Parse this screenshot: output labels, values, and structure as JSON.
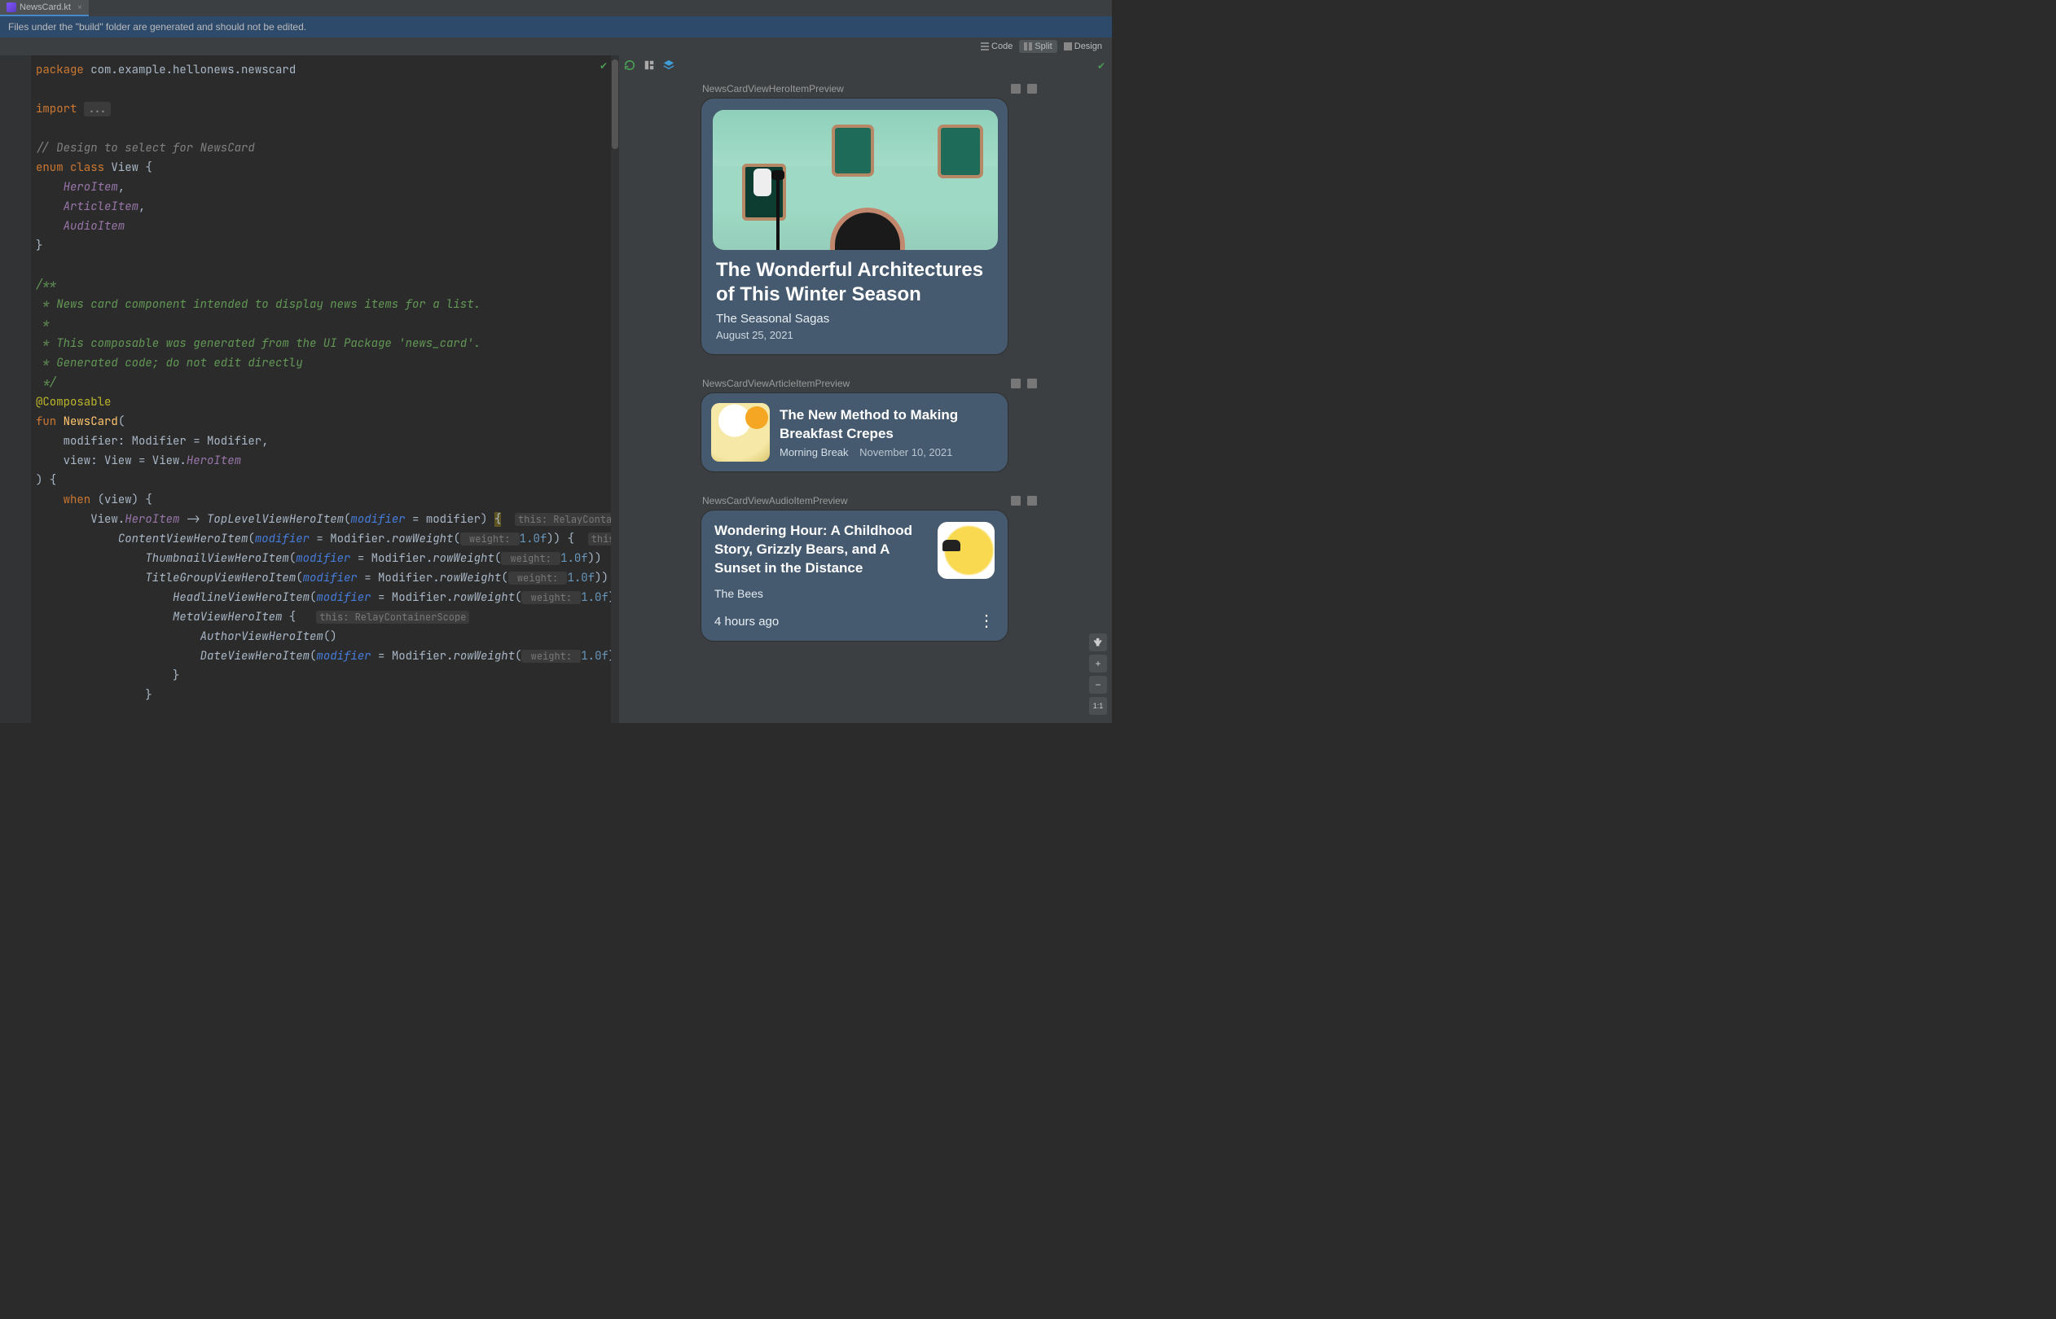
{
  "tab": {
    "filename": "NewsCard.kt"
  },
  "notice": "Files under the \"build\" folder are generated and should not be edited.",
  "viewModes": {
    "code": "Code",
    "split": "Split",
    "design": "Design",
    "selected": "Split"
  },
  "code": {
    "lines": [
      {
        "t": "pkg",
        "tokens": [
          [
            "kw",
            "package"
          ],
          [
            "sp",
            " "
          ],
          [
            "pkg",
            "com.example.hellonews.newscard"
          ]
        ]
      },
      {
        "t": "blank"
      },
      {
        "t": "imp",
        "tokens": [
          [
            "kw",
            "import"
          ],
          [
            "sp",
            " "
          ],
          [
            "fold",
            "..."
          ]
        ]
      },
      {
        "t": "blank"
      },
      {
        "t": "c",
        "text": "// Design to select for NewsCard"
      },
      {
        "tokens": [
          [
            "kw",
            "enum class"
          ],
          [
            "sp",
            " "
          ],
          [
            "type",
            "View"
          ],
          [
            "sp",
            " "
          ],
          [
            "brace",
            "{"
          ]
        ]
      },
      {
        "indent": 1,
        "tokens": [
          [
            "enum",
            "HeroItem"
          ],
          [
            "plain",
            ","
          ]
        ]
      },
      {
        "indent": 1,
        "tokens": [
          [
            "enum",
            "ArticleItem"
          ],
          [
            "plain",
            ","
          ]
        ]
      },
      {
        "indent": 1,
        "tokens": [
          [
            "enum",
            "AudioItem"
          ]
        ]
      },
      {
        "tokens": [
          [
            "brace",
            "}"
          ]
        ]
      },
      {
        "t": "blank"
      },
      {
        "t": "doc",
        "text": "/**"
      },
      {
        "t": "doc",
        "text": " * News card component intended to display news items for a list."
      },
      {
        "t": "doc",
        "text": " *"
      },
      {
        "t": "doc",
        "text": " * This composable was generated from the UI Package 'news_card'."
      },
      {
        "t": "doc",
        "text": " * Generated code; do not edit directly"
      },
      {
        "t": "doc",
        "text": " */"
      },
      {
        "tokens": [
          [
            "ann",
            "@Composable"
          ]
        ]
      },
      {
        "tokens": [
          [
            "kw",
            "fun"
          ],
          [
            "sp",
            " "
          ],
          [
            "fn",
            "NewsCard"
          ],
          [
            "plain",
            "("
          ]
        ]
      },
      {
        "indent": 1,
        "tokens": [
          [
            "param",
            "modifier: Modifier = Modifier"
          ],
          [
            "plain",
            ","
          ]
        ]
      },
      {
        "indent": 1,
        "tokens": [
          [
            "param",
            "view: View = View."
          ],
          [
            "enum",
            "HeroItem"
          ]
        ]
      },
      {
        "tokens": [
          [
            "plain",
            ") {"
          ]
        ]
      },
      {
        "indent": 1,
        "tokens": [
          [
            "kw",
            "when"
          ],
          [
            "sp",
            " "
          ],
          [
            "plain",
            "(view) {"
          ]
        ]
      },
      {
        "indent": 2,
        "tokens": [
          [
            "plain",
            "View."
          ],
          [
            "enum",
            "HeroItem"
          ],
          [
            "plain",
            " -> "
          ],
          [
            "call",
            "TopLevelViewHeroItem"
          ],
          [
            "plain",
            "("
          ],
          [
            "named",
            "modifier"
          ],
          [
            "plain",
            " = modifier) "
          ],
          [
            "hlbrace",
            "{"
          ],
          [
            "sp",
            "  "
          ],
          [
            "hint",
            "this: RelayContain"
          ]
        ]
      },
      {
        "indent": 3,
        "tokens": [
          [
            "call",
            "ContentViewHeroItem"
          ],
          [
            "plain",
            "("
          ],
          [
            "named",
            "modifier"
          ],
          [
            "plain",
            " = Modifier."
          ],
          [
            "call",
            "rowWeight"
          ],
          [
            "plain",
            "("
          ],
          [
            "hint",
            " weight: "
          ],
          [
            "num",
            "1.0f"
          ],
          [
            "plain",
            ")) {  "
          ],
          [
            "hint",
            "this: R"
          ]
        ]
      },
      {
        "indent": 4,
        "tokens": [
          [
            "call",
            "ThumbnailViewHeroItem"
          ],
          [
            "plain",
            "("
          ],
          [
            "named",
            "modifier"
          ],
          [
            "plain",
            " = Modifier."
          ],
          [
            "call",
            "rowWeight"
          ],
          [
            "plain",
            "("
          ],
          [
            "hint",
            " weight: "
          ],
          [
            "num",
            "1.0f"
          ],
          [
            "plain",
            "))"
          ]
        ]
      },
      {
        "indent": 4,
        "tokens": [
          [
            "call",
            "TitleGroupViewHeroItem"
          ],
          [
            "plain",
            "("
          ],
          [
            "named",
            "modifier"
          ],
          [
            "plain",
            " = Modifier."
          ],
          [
            "call",
            "rowWeight"
          ],
          [
            "plain",
            "("
          ],
          [
            "hint",
            " weight: "
          ],
          [
            "num",
            "1.0f"
          ],
          [
            "plain",
            ")) ·"
          ]
        ]
      },
      {
        "indent": 5,
        "tokens": [
          [
            "call",
            "HeadlineViewHeroItem"
          ],
          [
            "plain",
            "("
          ],
          [
            "named",
            "modifier"
          ],
          [
            "plain",
            " = Modifier."
          ],
          [
            "call",
            "rowWeight"
          ],
          [
            "plain",
            "("
          ],
          [
            "hint",
            " weight: "
          ],
          [
            "num",
            "1.0f"
          ],
          [
            "plain",
            "))"
          ]
        ]
      },
      {
        "indent": 5,
        "tokens": [
          [
            "call",
            "MetaViewHeroItem"
          ],
          [
            "plain",
            " {   "
          ],
          [
            "hint",
            "this: RelayContainerScope"
          ]
        ]
      },
      {
        "indent": 6,
        "tokens": [
          [
            "call",
            "AuthorViewHeroItem"
          ],
          [
            "plain",
            "()"
          ]
        ]
      },
      {
        "indent": 6,
        "tokens": [
          [
            "call",
            "DateViewHeroItem"
          ],
          [
            "plain",
            "("
          ],
          [
            "named",
            "modifier"
          ],
          [
            "plain",
            " = Modifier."
          ],
          [
            "call",
            "rowWeight"
          ],
          [
            "plain",
            "("
          ],
          [
            "hint",
            " weight: "
          ],
          [
            "num",
            "1.0f"
          ],
          [
            "plain",
            "))"
          ]
        ]
      },
      {
        "indent": 5,
        "tokens": [
          [
            "plain",
            "}"
          ]
        ]
      },
      {
        "indent": 4,
        "tokens": [
          [
            "plain",
            "}"
          ]
        ]
      }
    ]
  },
  "previews": {
    "hero": {
      "label": "NewsCardViewHeroItemPreview",
      "title": "The Wonderful Architectures of This Winter Season",
      "subtitle": "The Seasonal Sagas",
      "date": "August 25, 2021"
    },
    "article": {
      "label": "NewsCardViewArticleItemPreview",
      "title": "The New Method to Making Breakfast Crepes",
      "author": "Morning Break",
      "date": "November 10, 2021"
    },
    "audio": {
      "label": "NewsCardViewAudioItemPreview",
      "title": "Wondering Hour: A Childhood Story, Grizzly Bears, and A Sunset in the Distance",
      "author": "The Bees",
      "time": "4 hours ago"
    }
  },
  "zoomControls": {
    "plus": "+",
    "minus": "−",
    "ratio": "1:1"
  }
}
